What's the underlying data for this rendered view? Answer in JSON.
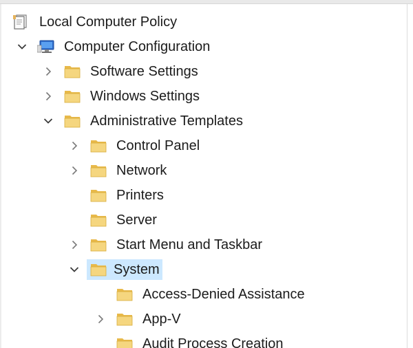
{
  "tree": {
    "root": {
      "label": "Local Computer Policy",
      "icon": "policy-document-icon"
    },
    "computer_configuration": {
      "label": "Computer Configuration",
      "icon": "computer-icon",
      "expanded": true
    },
    "software_settings": {
      "label": "Software Settings",
      "icon": "folder-icon"
    },
    "windows_settings": {
      "label": "Windows Settings",
      "icon": "folder-icon"
    },
    "administrative_templates": {
      "label": "Administrative Templates",
      "icon": "folder-icon",
      "expanded": true
    },
    "control_panel": {
      "label": "Control Panel",
      "icon": "folder-icon"
    },
    "network": {
      "label": "Network",
      "icon": "folder-icon"
    },
    "printers": {
      "label": "Printers",
      "icon": "folder-icon"
    },
    "server": {
      "label": "Server",
      "icon": "folder-icon"
    },
    "start_menu_and_taskbar": {
      "label": "Start Menu and Taskbar",
      "icon": "folder-icon"
    },
    "system": {
      "label": "System",
      "icon": "folder-icon",
      "expanded": true,
      "selected": true
    },
    "access_denied_assistance": {
      "label": "Access-Denied Assistance",
      "icon": "folder-icon"
    },
    "app_v": {
      "label": "App-V",
      "icon": "folder-icon"
    },
    "audit_process_creation": {
      "label": "Audit Process Creation",
      "icon": "folder-icon"
    }
  },
  "colors": {
    "selection": "#cce8ff",
    "folder": "#f2d37e",
    "text": "#1b1b1b"
  }
}
